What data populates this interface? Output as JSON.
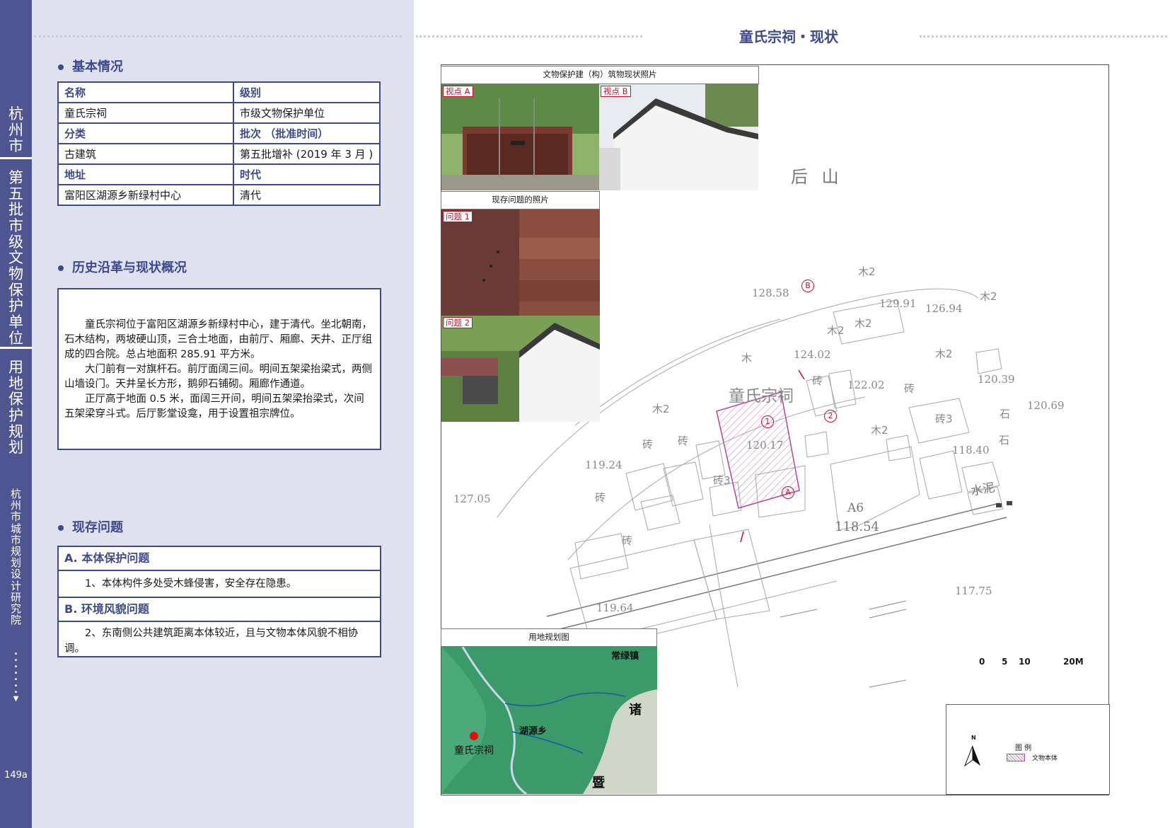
{
  "sidebar": {
    "city": "杭州市",
    "category": "第五批市级文物保护单位",
    "type": "用地保护规划",
    "institute": "杭州市城市规划设计研究院",
    "page_no": "149a"
  },
  "page_title": "童氏宗祠・现状",
  "basic": {
    "heading": "基本情况",
    "rows": [
      [
        "名称",
        "级别"
      ],
      [
        "童氏宗祠",
        "市级文物保护单位"
      ],
      [
        "分类",
        "批次 （批准时间）"
      ],
      [
        "古建筑",
        "第五批增补 (2019 年 3 月 )"
      ],
      [
        "地址",
        "时代"
      ],
      [
        "富阳区湖源乡新绿村中心",
        "清代"
      ]
    ]
  },
  "history": {
    "heading": "历史沿革与现状概况",
    "paragraphs": [
      "童氏宗祠位于富阳区湖源乡新绿村中心，建于清代。坐北朝南，石木结构，两坡硬山顶，三合土地面，由前厅、厢廊、天井、正厅组成的四合院。总占地面积 285.91 平方米。",
      "大门前有一对旗杆石。前厅面阔三间。明间五架梁抬梁式，两侧山墙设门。天井呈长方形，鹅卵石铺砌。厢廊作通道。",
      "正厅高于地面 0.5 米，面阔三开间，明间五架梁抬梁式，次间五架梁穿斗式。后厅影堂设龛，用于设置祖宗牌位。"
    ]
  },
  "problems": {
    "heading": "现存问题",
    "a_title": "A. 本体保护问题",
    "a_text": "1、本体构件多处受木蜂侵害，安全存在隐患。",
    "b_title": "B. 环境风貌问题",
    "b_text": "2、东南侧公共建筑距离本体较近，且与文物本体风貌不相协调。"
  },
  "photos": {
    "status_caption": "文物保护建（构）筑物现状照片",
    "view_a": "视点 A",
    "view_b": "视点 B",
    "issues_caption": "现存问题的照片",
    "issue_1": "问题 1",
    "issue_2": "问题 2",
    "landuse_caption": "用地规划图",
    "landuse_labels": [
      "常绿镇",
      "诸",
      "湖源乡",
      "童氏宗祠",
      "暨"
    ]
  },
  "map": {
    "hill": "后 山",
    "site": "童氏宗祠",
    "road": "A6",
    "road_elev": "118.54",
    "road_material": "水泥",
    "elevations": [
      "128.58",
      "129.91",
      "126.94",
      "124.02",
      "122.02",
      "120.39",
      "120.69",
      "120.17",
      "118.40",
      "119.24",
      "127.05",
      "119.64",
      "117.75"
    ],
    "buildings": [
      "木2",
      "木2",
      "木2",
      "木2",
      "木2",
      "木2",
      "木2",
      "木",
      "砖",
      "砖",
      "砖",
      "砖",
      "砖3",
      "砖3",
      "石",
      "石",
      "砖",
      "砖"
    ],
    "markers": [
      "A",
      "B",
      "1",
      "2"
    ],
    "scale": [
      "0",
      "5",
      "10",
      "20M"
    ],
    "north": "N"
  },
  "legend": {
    "title": "图 例",
    "item": "文物本体"
  },
  "colors": {
    "accent": "#3f4a8c",
    "sidebar": "#4f5591",
    "panel": "#dfe2ee",
    "marker": "#c8102e"
  }
}
